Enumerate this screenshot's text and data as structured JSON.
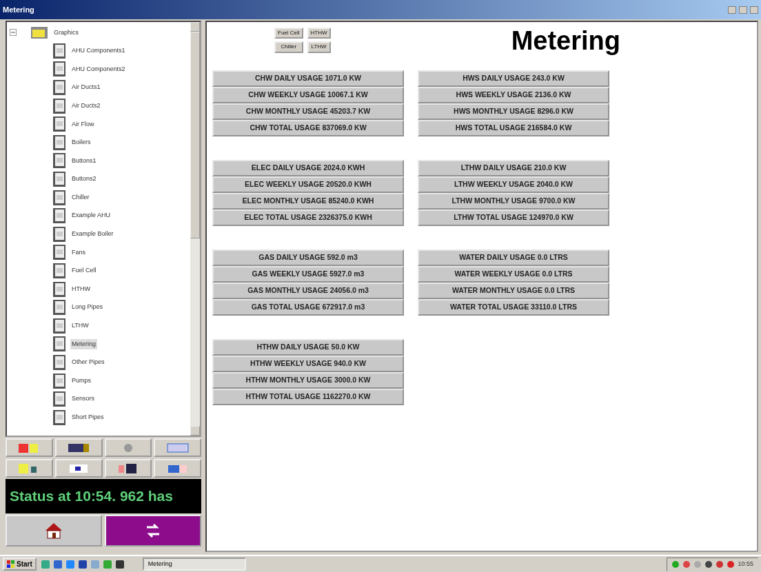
{
  "window": {
    "title": "Metering"
  },
  "tree": {
    "label": "Graphics",
    "expanded": true,
    "children": [
      {
        "label": "AHU Components1",
        "selected": false
      },
      {
        "label": "AHU Components2",
        "selected": false
      },
      {
        "label": "Air Ducts1",
        "selected": false
      },
      {
        "label": "Air Ducts2",
        "selected": false
      },
      {
        "label": "Air Flow",
        "selected": false
      },
      {
        "label": "Boilers",
        "selected": false
      },
      {
        "label": "Buttons1",
        "selected": false
      },
      {
        "label": "Buttons2",
        "selected": false
      },
      {
        "label": "Chiller",
        "selected": false
      },
      {
        "label": "Example AHU",
        "selected": false
      },
      {
        "label": "Example Boiler",
        "selected": false
      },
      {
        "label": "Fans",
        "selected": false
      },
      {
        "label": "Fuel Cell",
        "selected": false
      },
      {
        "label": "HTHW",
        "selected": false
      },
      {
        "label": "Long Pipes",
        "selected": false
      },
      {
        "label": "LTHW",
        "selected": false
      },
      {
        "label": "Metering",
        "selected": true
      },
      {
        "label": "Other Pipes",
        "selected": false
      },
      {
        "label": "Pumps",
        "selected": false
      },
      {
        "label": "Sensors",
        "selected": false
      },
      {
        "label": "Short Pipes",
        "selected": false
      }
    ]
  },
  "status_message": "Status at 10:54. 962 has",
  "quick_links": [
    "Fuel Cell",
    "HTHW",
    "Chiller",
    "LTHW"
  ],
  "page_title": "Metering",
  "groups": [
    {
      "readings": [
        "CHW DAILY USAGE 1071.0 KW",
        "CHW WEEKLY USAGE 10067.1 KW",
        "CHW MONTHLY USAGE 45203.7 KW",
        "CHW TOTAL USAGE 837069.0 KW"
      ]
    },
    {
      "readings": [
        "HWS DAILY USAGE 243.0 KW",
        "HWS WEEKLY USAGE 2136.0 KW",
        "HWS MONTHLY USAGE 8296.0 KW",
        "HWS TOTAL USAGE 216584.0 KW"
      ]
    },
    {
      "readings": [
        "ELEC DAILY USAGE 2024.0 KWH",
        "ELEC WEEKLY USAGE 20520.0 KWH",
        "ELEC MONTHLY USAGE 85240.0 KWH",
        "ELEC TOTAL USAGE 2326375.0 KWH"
      ]
    },
    {
      "readings": [
        "LTHW DAILY USAGE 210.0 KW",
        "LTHW WEEKLY USAGE 2040.0 KW",
        "LTHW MONTHLY USAGE 9700.0 KW",
        "LTHW TOTAL USAGE 124970.0 KW"
      ]
    },
    {
      "readings": [
        "GAS DAILY USAGE 592.0 m3",
        "GAS WEEKLY USAGE 5927.0 m3",
        "GAS MONTHLY USAGE 24056.0 m3",
        "GAS TOTAL USAGE 672917.0 m3"
      ]
    },
    {
      "readings": [
        "WATER DAILY USAGE 0.0 LTRS",
        "WATER WEEKLY USAGE 0.0 LTRS",
        "WATER MONTHLY USAGE 0.0 LTRS",
        "WATER TOTAL USAGE 33110.0 LTRS"
      ]
    },
    {
      "readings": [
        "HTHW DAILY USAGE 50.0 KW",
        "HTHW WEEKLY USAGE 940.0 KW",
        "HTHW MONTHLY USAGE 3000.0 KW",
        "HTHW TOTAL USAGE 1162270.0 KW"
      ]
    }
  ],
  "taskbar": {
    "start": "Start",
    "task": "Metering",
    "clock": "10:55"
  }
}
